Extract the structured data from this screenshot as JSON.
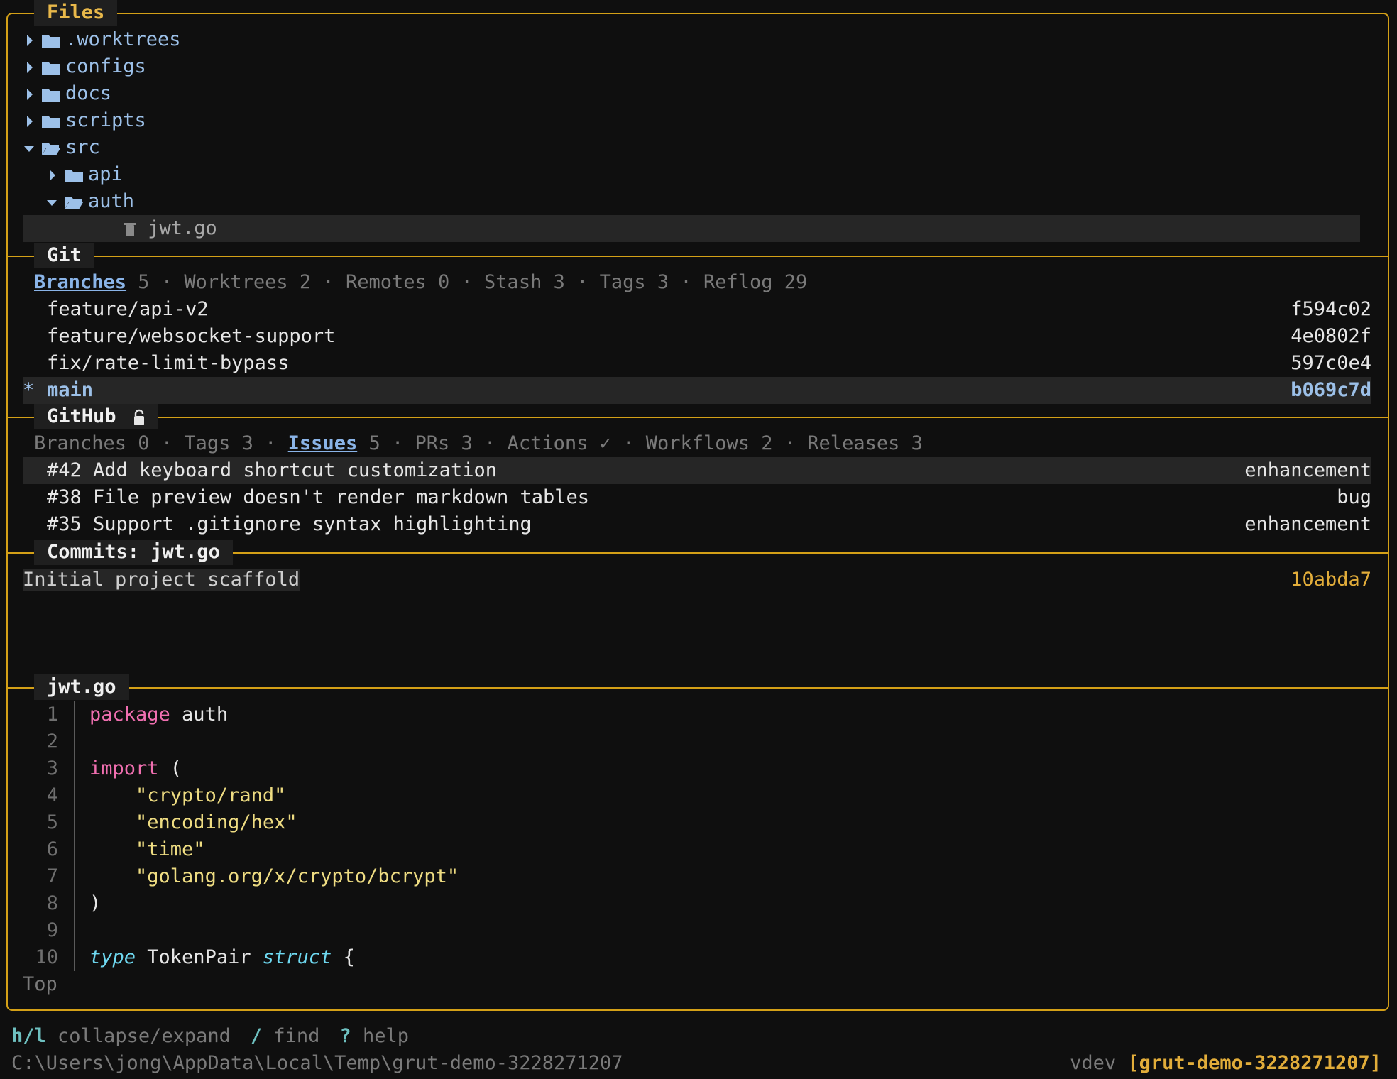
{
  "files": {
    "title": "Files",
    "items": [
      {
        "name": ".worktrees",
        "open": false
      },
      {
        "name": "configs",
        "open": false
      },
      {
        "name": "docs",
        "open": false
      },
      {
        "name": "scripts",
        "open": false
      },
      {
        "name": "src",
        "open": true
      },
      {
        "name": "api",
        "open": false
      },
      {
        "name": "auth",
        "open": true
      },
      {
        "name": "jwt.go",
        "icon": "trash-icon"
      }
    ]
  },
  "git": {
    "title": "Git",
    "tabs": [
      {
        "label": "Branches",
        "count": "5"
      },
      {
        "label": "Worktrees",
        "count": "2"
      },
      {
        "label": "Remotes",
        "count": "0"
      },
      {
        "label": "Stash",
        "count": "3"
      },
      {
        "label": "Tags",
        "count": "3"
      },
      {
        "label": "Reflog",
        "count": "29"
      }
    ],
    "separator": "·",
    "branches": [
      {
        "marker": "",
        "name": "feature/api-v2",
        "hash": "f594c02"
      },
      {
        "marker": "",
        "name": "feature/websocket-support",
        "hash": "4e0802f"
      },
      {
        "marker": "",
        "name": "fix/rate-limit-bypass",
        "hash": "597c0e4"
      },
      {
        "marker": "*",
        "name": "main",
        "hash": "b069c7d"
      }
    ]
  },
  "github": {
    "title": "GitHub",
    "tabs": [
      {
        "label": "Branches",
        "count": "0"
      },
      {
        "label": "Tags",
        "count": "3"
      },
      {
        "label": "Issues",
        "count": "5"
      },
      {
        "label": "PRs",
        "count": "3"
      },
      {
        "label": "Actions",
        "count": "✓"
      },
      {
        "label": "Workflows",
        "count": "2"
      },
      {
        "label": "Releases",
        "count": "3"
      }
    ],
    "issues": [
      {
        "text": "#42 Add keyboard shortcut customization",
        "label": "enhancement"
      },
      {
        "text": "#38 File preview doesn't render markdown tables",
        "label": "bug"
      },
      {
        "text": "#35 Support .gitignore syntax highlighting",
        "label": "enhancement"
      }
    ]
  },
  "commits": {
    "title": "Commits: jwt.go",
    "items": [
      {
        "message": "Initial project scaffold",
        "hash": "10abda7"
      }
    ]
  },
  "preview": {
    "title": "jwt.go",
    "lines": [
      {
        "n": "1",
        "parts": [
          {
            "t": "package",
            "c": "kw"
          },
          {
            "t": " auth",
            "c": ""
          }
        ]
      },
      {
        "n": "2",
        "parts": []
      },
      {
        "n": "3",
        "parts": [
          {
            "t": "import",
            "c": "kw"
          },
          {
            "t": " (",
            "c": ""
          }
        ]
      },
      {
        "n": "4",
        "parts": [
          {
            "t": "    ",
            "c": ""
          },
          {
            "t": "\"crypto/rand\"",
            "c": "str"
          }
        ]
      },
      {
        "n": "5",
        "parts": [
          {
            "t": "    ",
            "c": ""
          },
          {
            "t": "\"encoding/hex\"",
            "c": "str"
          }
        ]
      },
      {
        "n": "6",
        "parts": [
          {
            "t": "    ",
            "c": ""
          },
          {
            "t": "\"time\"",
            "c": "str"
          }
        ]
      },
      {
        "n": "7",
        "parts": [
          {
            "t": "    ",
            "c": ""
          },
          {
            "t": "\"golang.org/x/crypto/bcrypt\"",
            "c": "str"
          }
        ]
      },
      {
        "n": "8",
        "parts": [
          {
            "t": ")",
            "c": ""
          }
        ]
      },
      {
        "n": "9",
        "parts": []
      },
      {
        "n": "10",
        "parts": [
          {
            "t": "type",
            "c": "typ"
          },
          {
            "t": " TokenPair ",
            "c": ""
          },
          {
            "t": "struct",
            "c": "typ"
          },
          {
            "t": " {",
            "c": ""
          }
        ]
      }
    ],
    "position": "Top"
  },
  "footer": {
    "hints": [
      {
        "key": "h/l",
        "label": "collapse/expand"
      },
      {
        "key": "/",
        "label": "find"
      },
      {
        "key": "?",
        "label": "help"
      }
    ],
    "path": "C:\\Users\\jong\\AppData\\Local\\Temp\\grut-demo-3228271207",
    "branch": "vdev",
    "session": "[grut-demo-3228271207]"
  },
  "colors": {
    "border": "#d4a017",
    "accent": "#e2ad3a",
    "keyword": "#f06fb0",
    "string": "#eedc82",
    "type": "#6ed8f0"
  }
}
